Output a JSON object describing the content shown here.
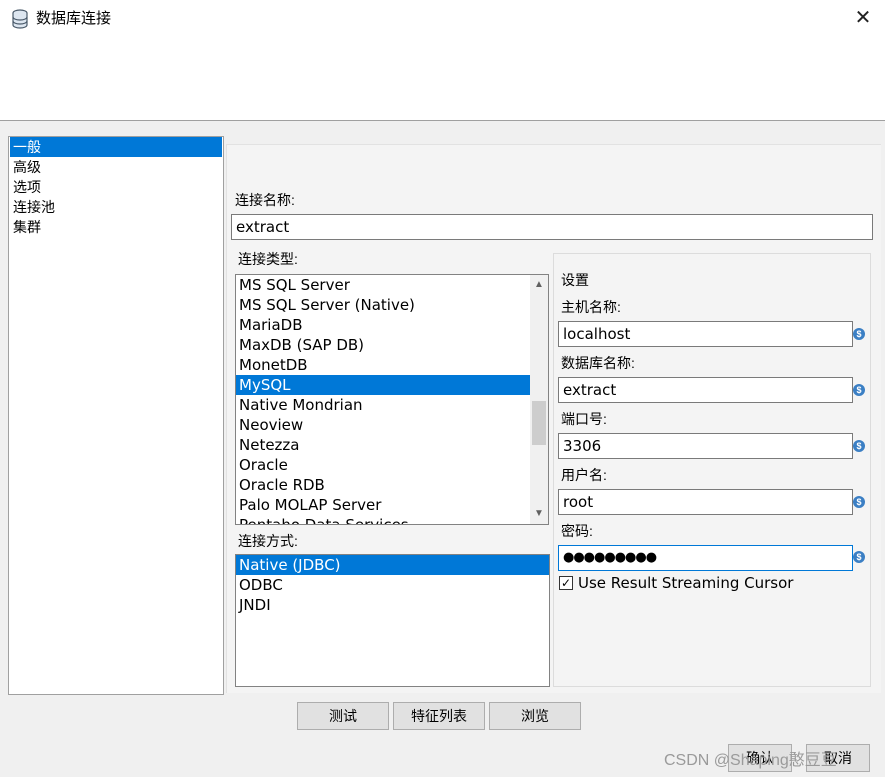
{
  "window": {
    "title": "数据库连接",
    "icon": "database-icon",
    "close_symbol": "✕"
  },
  "nav": {
    "items": [
      {
        "label": "一般",
        "selected": true
      },
      {
        "label": "高级",
        "selected": false
      },
      {
        "label": "选项",
        "selected": false
      },
      {
        "label": "连接池",
        "selected": false
      },
      {
        "label": "集群",
        "selected": false
      }
    ]
  },
  "connection_name": {
    "label": "连接名称:",
    "value": "extract"
  },
  "connection_type": {
    "label": "连接类型:",
    "items": [
      "MS SQL Server",
      "MS SQL Server (Native)",
      "MariaDB",
      "MaxDB (SAP DB)",
      "MonetDB",
      "MySQL",
      "Native Mondrian",
      "Neoview",
      "Netezza",
      "Oracle",
      "Oracle RDB",
      "Palo MOLAP Server",
      "Pentaho Data Services"
    ],
    "selected": "MySQL"
  },
  "access": {
    "label": "连接方式:",
    "items": [
      "Native (JDBC)",
      "ODBC",
      "JNDI"
    ],
    "selected": "Native (JDBC)"
  },
  "settings": {
    "heading": "设置",
    "host_label": "主机名称:",
    "host_value": "localhost",
    "db_label": "数据库名称:",
    "db_value": "extract",
    "port_label": "端口号:",
    "port_value": "3306",
    "user_label": "用户名:",
    "user_value": "root",
    "password_label": "密码:",
    "password_value": "●●●●●●●●●",
    "streaming_label": "Use Result Streaming Cursor",
    "streaming_checked": true,
    "variable_icon": "variable-icon",
    "variable_symbol": "$"
  },
  "buttons": {
    "test": "测试",
    "features": "特征列表",
    "explore": "浏览",
    "ok": "确认",
    "cancel": "取消"
  },
  "colors": {
    "selection": "#0078d7",
    "variable_icon": "#3b7fc4"
  },
  "watermark": "CSDN @Shaping憨豆豆"
}
